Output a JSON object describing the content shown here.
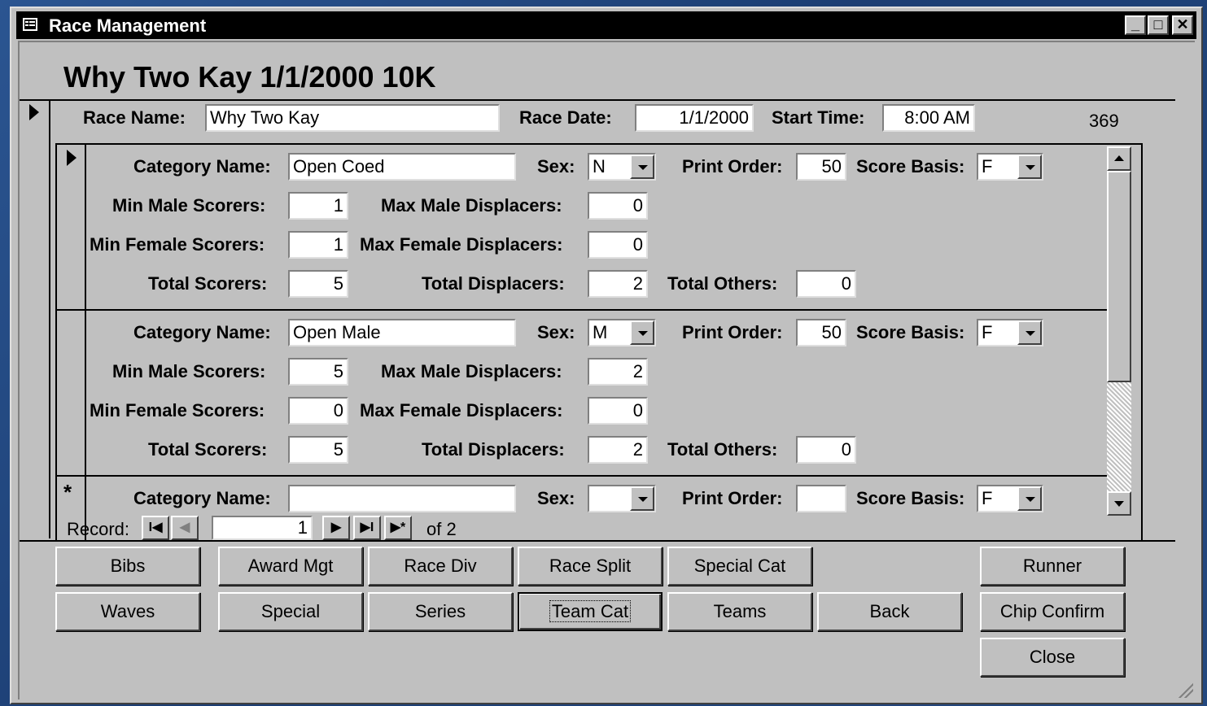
{
  "window": {
    "title": "Race Management"
  },
  "titlebar_buttons": {
    "minimize": "_",
    "maximize": "□",
    "close": "✕"
  },
  "heading": "Why Two Kay 1/1/2000 10K",
  "race": {
    "name_label": "Race Name:",
    "name_value": "Why Two Kay",
    "date_label": "Race Date:",
    "date_value": "1/1/2000",
    "start_label": "Start Time:",
    "start_value": "8:00 AM",
    "record_id": "369"
  },
  "labels": {
    "category_name": "Category Name:",
    "sex": "Sex:",
    "print_order": "Print Order:",
    "score_basis": "Score Basis:",
    "min_male_scorers": "Min Male Scorers:",
    "max_male_displacers": "Max Male Displacers:",
    "min_female_scorers": "Min Female Scorers:",
    "max_female_displacers": "Max Female Displacers:",
    "total_scorers": "Total Scorers:",
    "total_displacers": "Total Displacers:",
    "total_others": "Total Others:"
  },
  "categories": [
    {
      "category_name": "Open Coed",
      "sex": "N",
      "print_order": "50",
      "score_basis": "F",
      "min_male_scorers": "1",
      "max_male_displacers": "0",
      "min_female_scorers": "1",
      "max_female_displacers": "0",
      "total_scorers": "5",
      "total_displacers": "2",
      "total_others": "0"
    },
    {
      "category_name": "Open Male",
      "sex": "M",
      "print_order": "50",
      "score_basis": "F",
      "min_male_scorers": "5",
      "max_male_displacers": "2",
      "min_female_scorers": "0",
      "max_female_displacers": "0",
      "total_scorers": "5",
      "total_displacers": "2",
      "total_others": "0"
    },
    {
      "category_name": "",
      "sex": "",
      "print_order": "",
      "score_basis": "F"
    }
  ],
  "new_record_marker": "*",
  "navigation": {
    "record_label": "Record:",
    "first": "I◀",
    "prev": "◀",
    "current": "1",
    "next": "▶",
    "last": "▶I",
    "new": "▶*",
    "of_text": "of  2"
  },
  "buttons": {
    "bibs": "Bibs",
    "award_mgt": "Award Mgt",
    "race_div": "Race Div",
    "race_split": "Race Split",
    "special_cat": "Special Cat",
    "runner": "Runner",
    "waves": "Waves",
    "special": "Special",
    "series": "Series",
    "team_cat": "Team Cat",
    "teams": "Teams",
    "back": "Back",
    "chip_confirm": "Chip Confirm",
    "close": "Close"
  }
}
